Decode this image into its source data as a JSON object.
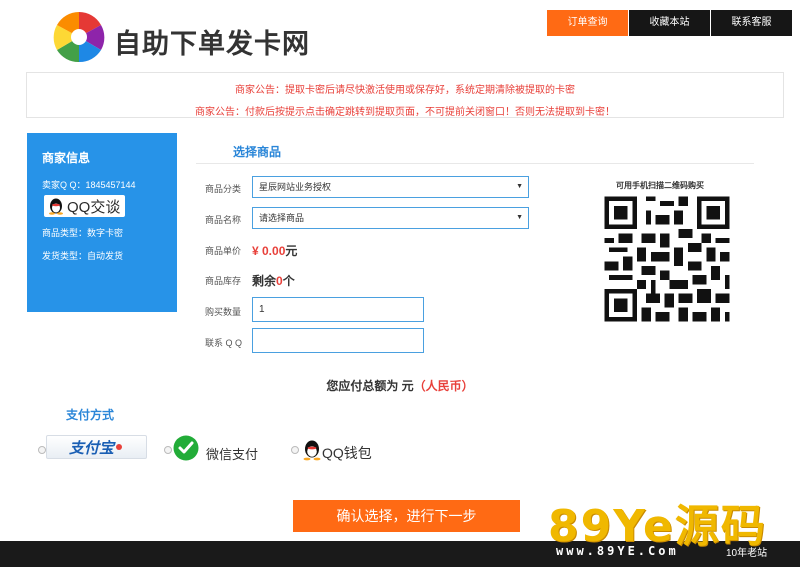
{
  "header": {
    "title": "自助下单发卡网",
    "nav": [
      "订单查询",
      "收藏本站",
      "联系客服"
    ],
    "active_nav": 0
  },
  "notices": [
    "商家公告：提取卡密后请尽快激活使用或保存好，系统定期清除被提取的卡密",
    "商家公告：付款后按提示点击确定跳转到提取页面，不可提前关闭窗口！否则无法提取到卡密！"
  ],
  "merchant": {
    "title": "商家信息",
    "qq": "卖家Q Q：1845457144",
    "qq_chat_label": "QQ交谈",
    "goods_type": "商品类型：数字卡密",
    "delivery_type": "发货类型：自动发货"
  },
  "form": {
    "section_title": "选择商品",
    "category_label": "商品分类",
    "category_value": "星辰网站业务授权",
    "name_label": "商品名称",
    "name_value": "请选择商品",
    "price_label": "商品单价",
    "price_value": "¥ 0.00",
    "price_unit": "元",
    "stock_label": "商品库存",
    "stock_prefix": "剩余",
    "stock_num": "0",
    "stock_unit": "个",
    "qty_label": "购买数量",
    "qty_value": "1",
    "contact_label": "联系 Q Q",
    "contact_value": ""
  },
  "qr": {
    "caption": "可用手机扫描二维码购买"
  },
  "total": {
    "prefix": "您应付总额为 元",
    "currency": "（人民币）"
  },
  "payment": {
    "title": "支付方式",
    "alipay_label": "支付宝",
    "wechat_label": "微信支付",
    "qqwallet_label": "QQ钱包"
  },
  "confirm_label": "确认选择，进行下一步",
  "watermark": {
    "brand": "89Ye源码",
    "url": "www.89YE.Com",
    "badge": "10年老站"
  },
  "colors": {
    "accent_orange": "#ff6a14",
    "panel_blue": "#2793e8",
    "notice_red": "#e8403a",
    "link_blue": "#2a86d8"
  }
}
